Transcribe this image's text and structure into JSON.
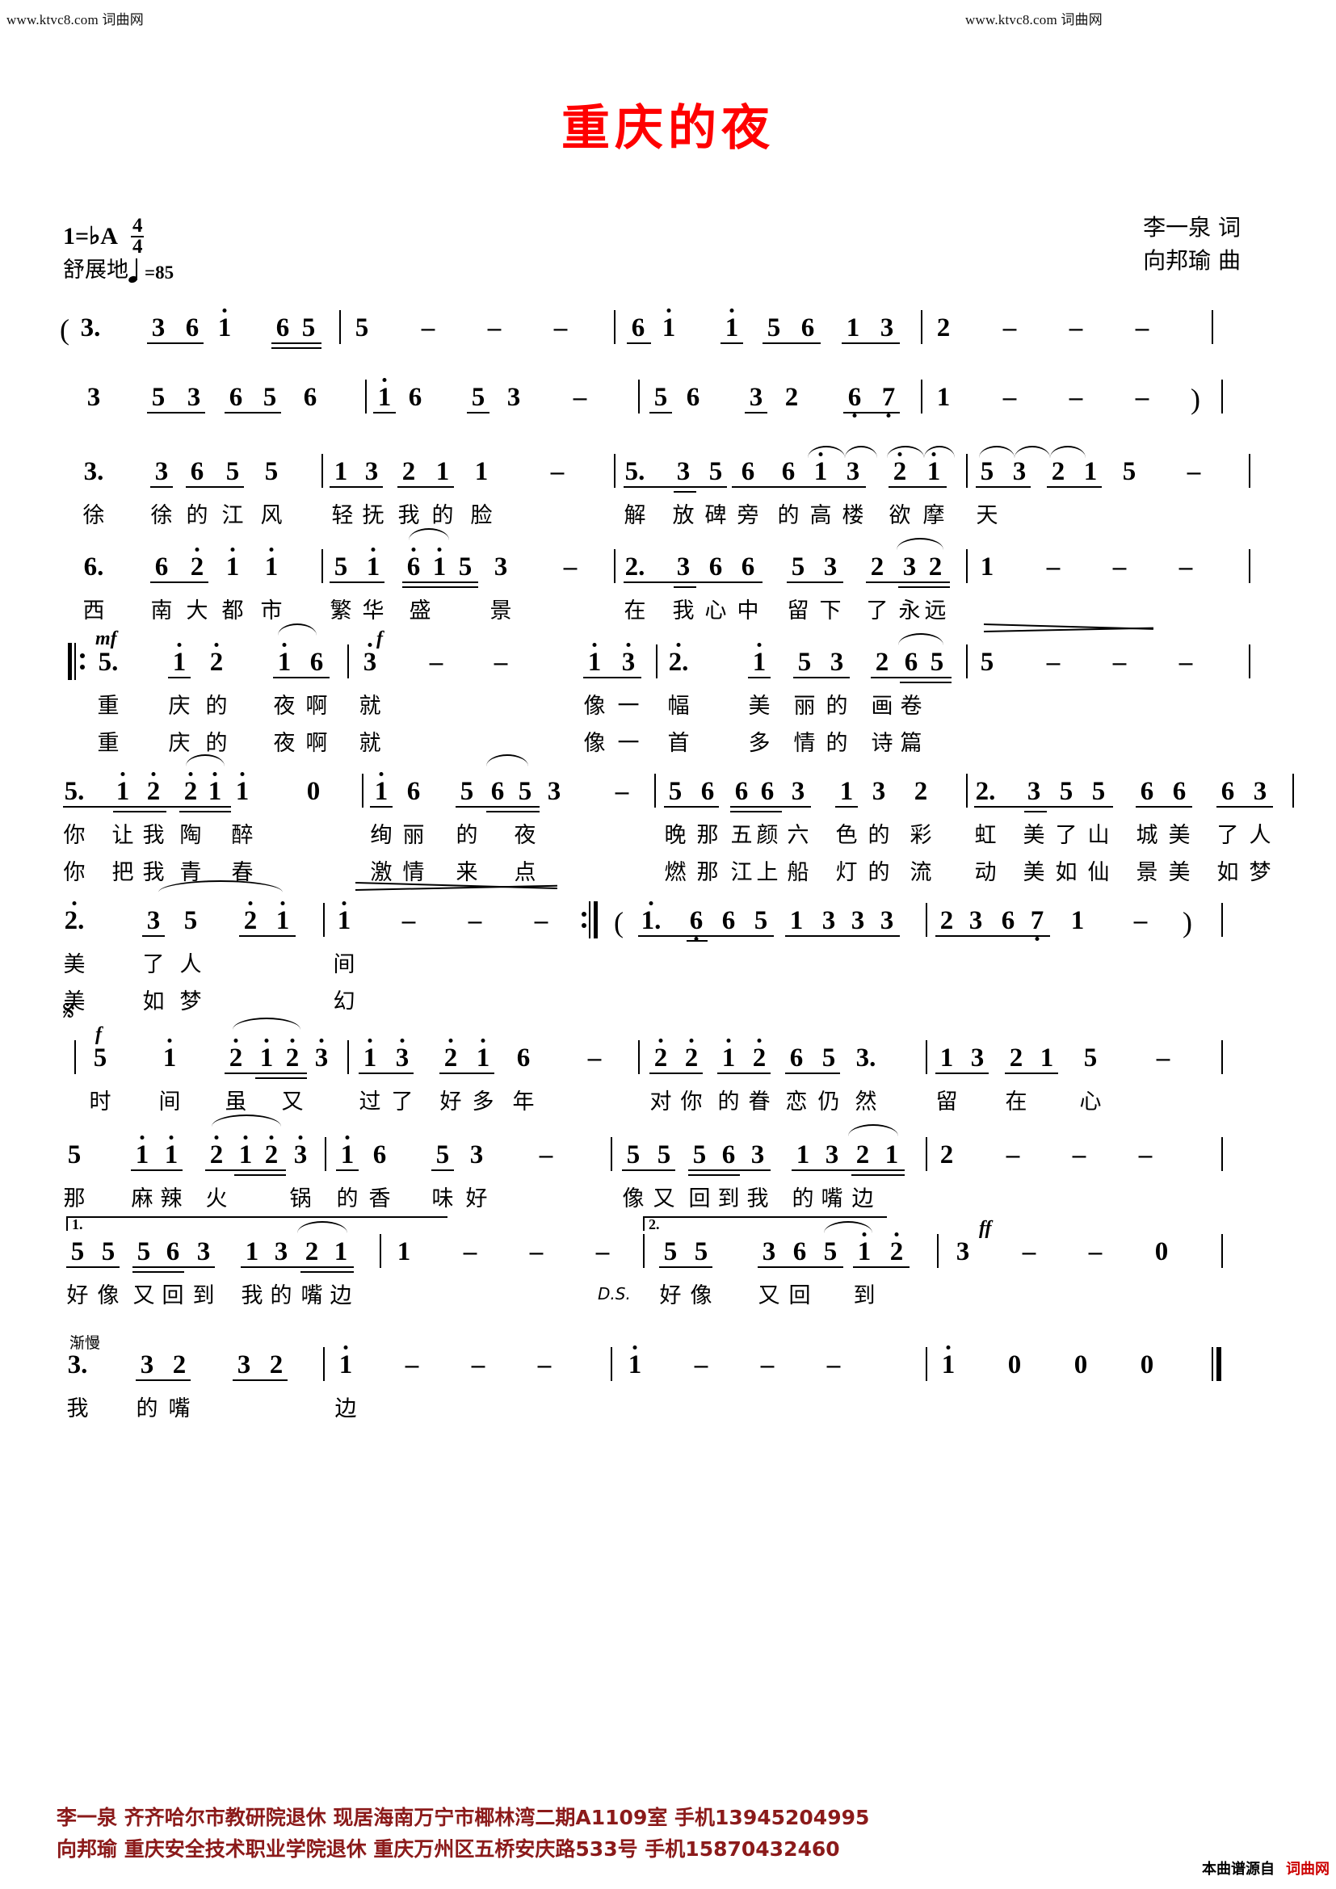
{
  "watermark": {
    "left": "www.ktvc8.com  词曲网",
    "right": "www.ktvc8.com  词曲网"
  },
  "title": "重庆的夜",
  "title_color": "#ff0000",
  "header": {
    "key_label": "1=",
    "key_value": "♭A",
    "meter_num": "4",
    "meter_den": "4",
    "tempo_style": "舒展地",
    "tempo_bpm": "=85",
    "lyricist": "李一泉  词",
    "composer": "向邦瑜  曲"
  },
  "score": {
    "systems": [
      {
        "id": "system-1-intro-a",
        "notes": "( 3.    3 6 i   65 | 5  -  -  - | 6 i   i 5 6 1 3 | 2  -  -  - |",
        "lyrics": []
      },
      {
        "id": "system-2-intro-b",
        "notes": "3   5 3 6 5 6 | i 6   5 3  - | 5 6   3 2   6 7 | 1  -  -  -  ) |",
        "lyrics": []
      },
      {
        "id": "system-3-verse1-a",
        "notes": "3.    3 6 5 5 | 1 3 2 1 1  - | 5. 3 5 6 6 i 3  2 i | 5 3 2 1 5  - |",
        "lyrics": [
          "徐　徐的江风　轻抚我的脸　　解放碑旁的高　楼　欲 摩 天"
        ]
      },
      {
        "id": "system-4-verse1-b",
        "notes": "6.    6 2 i i | 5 i 6 i 5 3  - | 2. 3 6 6 5 3 2 3 2 | 1  -  -  - |",
        "lyrics": [
          "西　南大都市　繁华盛　景　　在我心中留下了永 远"
        ]
      },
      {
        "id": "system-5-chorus-a",
        "notes": "‖: 5.   i 2  i 6 | 3  -  -  i 3 | 2.   i 5 3 2 6 5 | 5  -  -  - |",
        "dynamics": [
          "mf",
          "f"
        ],
        "lyrics": [
          "重　庆的　夜　啊　　　就像一　幅美丽的画 卷",
          "重　庆的　夜　啊　　　就像一　首多情的诗 篇"
        ]
      },
      {
        "id": "system-6-chorus-b",
        "notes": "5. i 2 2 i i    0 | i 6  5 6 5 3  - | 5 6 6 6 3 1 3 2 | 2. 3 5 5 6 6 6 3 |",
        "lyrics": [
          "你让我陶醉　　绚丽的夜晚　　那五颜六色的彩虹　美了山城美了人间",
          "你把我青春　　激情来点燃　　那江上船灯的流动　美如仙景美如梦幻"
        ]
      },
      {
        "id": "system-7-chorus-c",
        "notes": "2.   3 5   2 i | i  -  -  - :‖ ( i. 6 6 5 1 3 3 3 | 2 3 6 7 1  -  ) |",
        "lyrics": [
          "美　了人　　间",
          "美　如梦　　幻"
        ]
      },
      {
        "id": "system-8-verse2-a",
        "notes": "| 5   i   2 i 2 3 | i 3 2 i 6  - | 2 2 i 2 6 5 3. | 1 3 2 1 5  - |",
        "dynamics": [
          "f"
        ],
        "segno": "𝄋",
        "lyrics": [
          "时　间　虽　又　　过了好多年　　对你的眷恋仍然　　留在心　间"
        ]
      },
      {
        "id": "system-9-verse2-b",
        "notes": "5   i i   2 i 2 3 | i 6   5 3  - | 5 5 5 6 3 1 3 2 1 | 2  -  -  - |",
        "lyrics": [
          "那　麻辣火　锅　的香　味　　好像又回到我的嘴　　边"
        ]
      },
      {
        "id": "system-10-endings",
        "volta1": "1.",
        "volta2": "2.",
        "ds": "D.S.",
        "dynamic_ff": "ff",
        "notes": "5 5 5 6 3  1 3 2 1 | 1  -  -  - | 5 5   3 6 5 i 2 | 3  -  -  0 |",
        "lyrics": [
          "好像又回到我的嘴　　边　　　　　　　好像　又　回　　到"
        ]
      },
      {
        "id": "system-11-coda",
        "mark": "渐慢",
        "notes": "3.   3 2   3 2 | i  -  -  - | i  -  -  - | i  0  0  0 ‖",
        "lyrics": [
          "我　的嘴　　边"
        ]
      }
    ]
  },
  "footer": {
    "line1": "李一泉  齐齐哈尔市教研院退休  现居海南万宁市椰林湾二期A1109室  手机13945204995",
    "line2": "向邦瑜  重庆安全技术职业学院退休  重庆万州区五桥安庆路533号  手机15870432460",
    "color": "#8b1a1a"
  },
  "source": {
    "prefix": "本曲谱源自",
    "site": "词曲网"
  }
}
